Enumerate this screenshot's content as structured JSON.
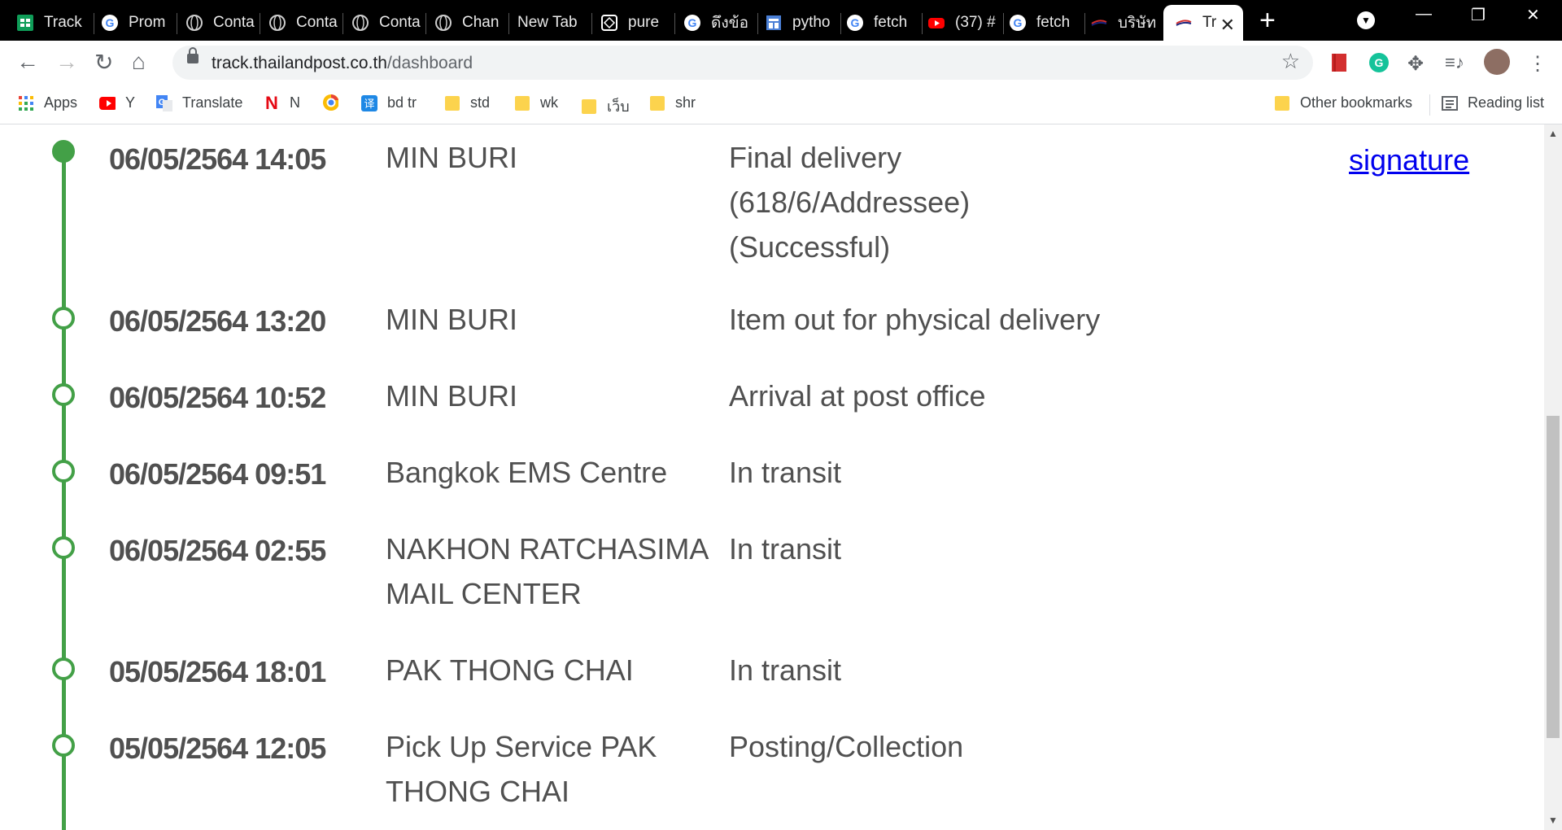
{
  "browser": {
    "tabs": [
      {
        "title": "Track",
        "icon": "sheets-icon"
      },
      {
        "title": "Prom",
        "icon": "google-icon"
      },
      {
        "title": "Conta",
        "icon": "globe-icon"
      },
      {
        "title": "Conta",
        "icon": "globe-icon"
      },
      {
        "title": "Conta",
        "icon": "globe-icon"
      },
      {
        "title": "Chan",
        "icon": "globe-icon"
      },
      {
        "title": "New Tab",
        "icon": ""
      },
      {
        "title": "pure",
        "icon": "codepen-icon"
      },
      {
        "title": "ดึงข้อ",
        "icon": "google-icon"
      },
      {
        "title": "pytho",
        "icon": "docs-icon"
      },
      {
        "title": "fetch",
        "icon": "google-icon"
      },
      {
        "title": "(37) #",
        "icon": "youtube-icon"
      },
      {
        "title": "fetch",
        "icon": "google-icon"
      },
      {
        "title": "บริษัท",
        "icon": "thaipost-icon"
      },
      {
        "title": "Tr",
        "icon": "thaipost-icon",
        "active": true
      }
    ],
    "url_host": "track.thailandpost.co.th",
    "url_path": "/dashboard",
    "bookmarks": [
      {
        "label": "Apps",
        "icon": "apps-grid-icon"
      },
      {
        "label": "Y",
        "icon": "youtube-icon"
      },
      {
        "label": "Translate",
        "icon": "translate-icon"
      },
      {
        "label": "N",
        "icon": "netflix-icon"
      },
      {
        "label": "",
        "icon": "chrome-web-store-icon"
      },
      {
        "label": "bd tr",
        "icon": "translator-icon"
      },
      {
        "label": "std",
        "icon": "folder-icon"
      },
      {
        "label": "wk",
        "icon": "folder-icon"
      },
      {
        "label": "เว็บ",
        "icon": "folder-icon"
      },
      {
        "label": "shr",
        "icon": "folder-icon"
      }
    ],
    "other_bookmarks": "Other bookmarks",
    "reading_list": "Reading list"
  },
  "tracking": {
    "signature_link": "signature",
    "events": [
      {
        "datetime": "06/05/2564 14:05",
        "location": "MIN BURI",
        "status": "Final delivery (618/6/Addressee) (Successful)",
        "current": true
      },
      {
        "datetime": "06/05/2564 13:20",
        "location": "MIN BURI",
        "status": "Item out for physical delivery"
      },
      {
        "datetime": "06/05/2564 10:52",
        "location": "MIN BURI",
        "status": "Arrival at post office"
      },
      {
        "datetime": "06/05/2564 09:51",
        "location": "Bangkok EMS Centre",
        "status": "In transit"
      },
      {
        "datetime": "06/05/2564 02:55",
        "location": "NAKHON RATCHASIMA MAIL CENTER",
        "status": "In transit"
      },
      {
        "datetime": "05/05/2564 18:01",
        "location": "PAK THONG CHAI",
        "status": "In transit"
      },
      {
        "datetime": "05/05/2564 12:05",
        "location": "Pick Up Service PAK THONG CHAI",
        "status": "Posting/Collection"
      }
    ]
  },
  "colors": {
    "timeline": "#43a047",
    "text": "#505050",
    "link": "#0000ee"
  }
}
